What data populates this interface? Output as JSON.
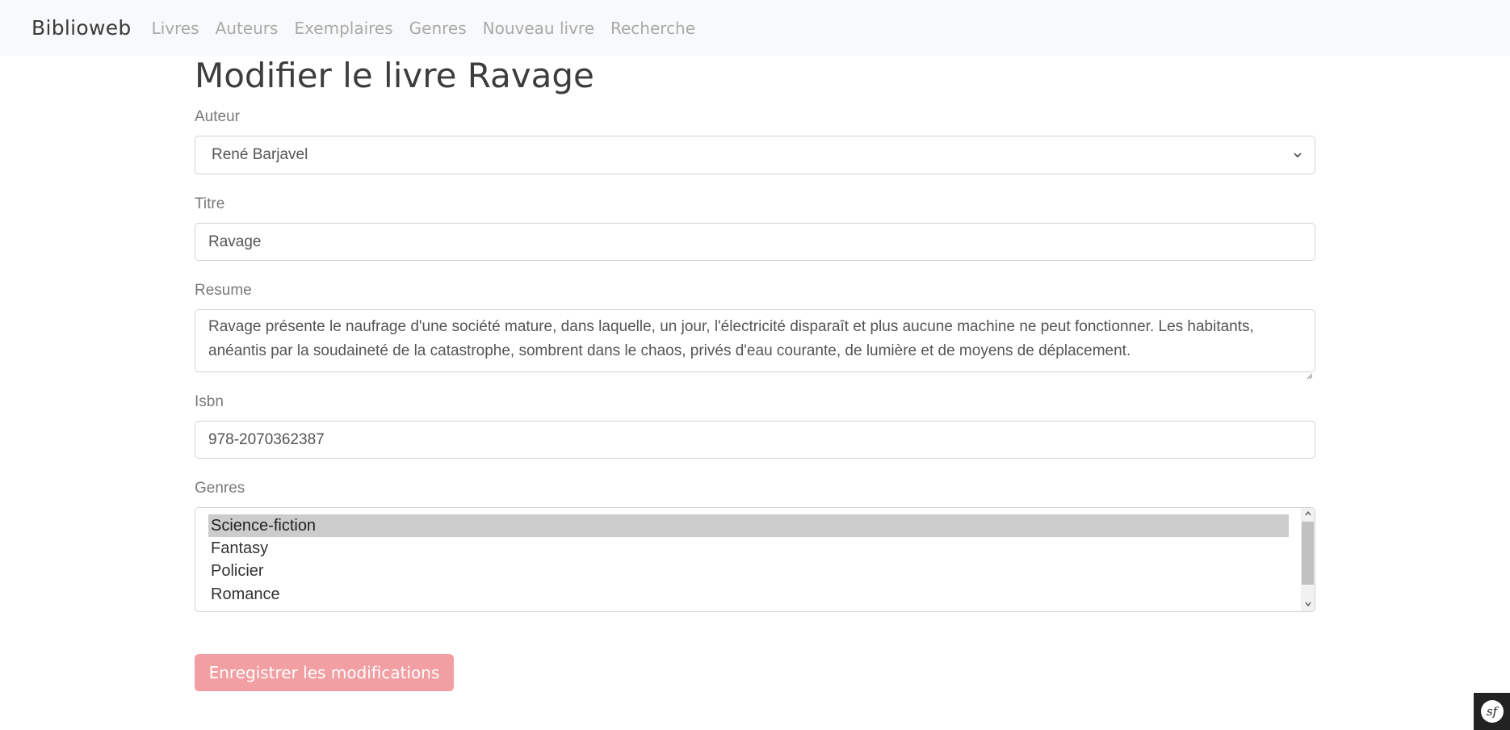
{
  "navbar": {
    "brand": "Biblioweb",
    "links": [
      "Livres",
      "Auteurs",
      "Exemplaires",
      "Genres",
      "Nouveau livre",
      "Recherche"
    ]
  },
  "page": {
    "title": "Modifier le livre Ravage"
  },
  "form": {
    "auteur": {
      "label": "Auteur",
      "value": "René Barjavel"
    },
    "titre": {
      "label": "Titre",
      "value": "Ravage"
    },
    "resume": {
      "label": "Resume",
      "value": "Ravage présente le naufrage d'une société mature, dans laquelle, un jour, l'électricité disparaît et plus aucune machine ne peut fonctionner. Les habitants, anéantis par la soudaineté de la catastrophe, sombrent dans le chaos, privés d'eau courante, de lumière et de moyens de déplacement."
    },
    "isbn": {
      "label": "Isbn",
      "value": "978-2070362387"
    },
    "genres": {
      "label": "Genres",
      "options": [
        "Science-fiction",
        "Fantasy",
        "Policier",
        "Romance"
      ],
      "selected": "Science-fiction"
    },
    "submit_label": "Enregistrer les modifications"
  },
  "toolbar": {
    "logo_text": "sf"
  },
  "colors": {
    "navbar_bg": "#f8f9fa",
    "button_bg": "#f19fa3",
    "selected_option_bg": "#cccccc"
  }
}
